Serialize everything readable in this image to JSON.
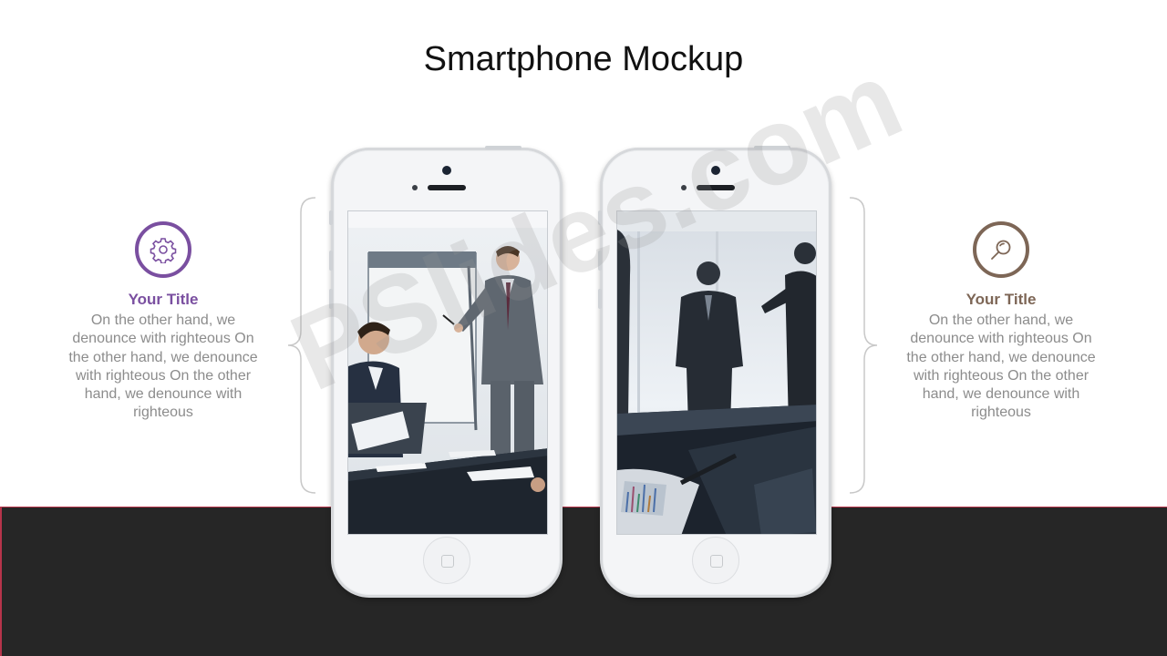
{
  "slide": {
    "title": "Smartphone Mockup",
    "accent_left": "#7a4fa0",
    "accent_right": "#7d6656",
    "band_color": "#262626"
  },
  "left_block": {
    "icon": "gear-icon",
    "title": "Your Title",
    "text": "On the other hand, we denounce with righteous On the other hand, we denounce with righteous On the other hand, we denounce with righteous"
  },
  "right_block": {
    "icon": "magnifier-icon",
    "title": "Your Title",
    "text": "On the other hand, we denounce with righteous On the other hand, we denounce with righteous On the other hand, we denounce with righteous"
  },
  "phones": [
    {
      "screen_image": "business-meeting-presentation-photo"
    },
    {
      "screen_image": "silhouettes-business-people-photo"
    }
  ],
  "watermark": "PSlides.com"
}
